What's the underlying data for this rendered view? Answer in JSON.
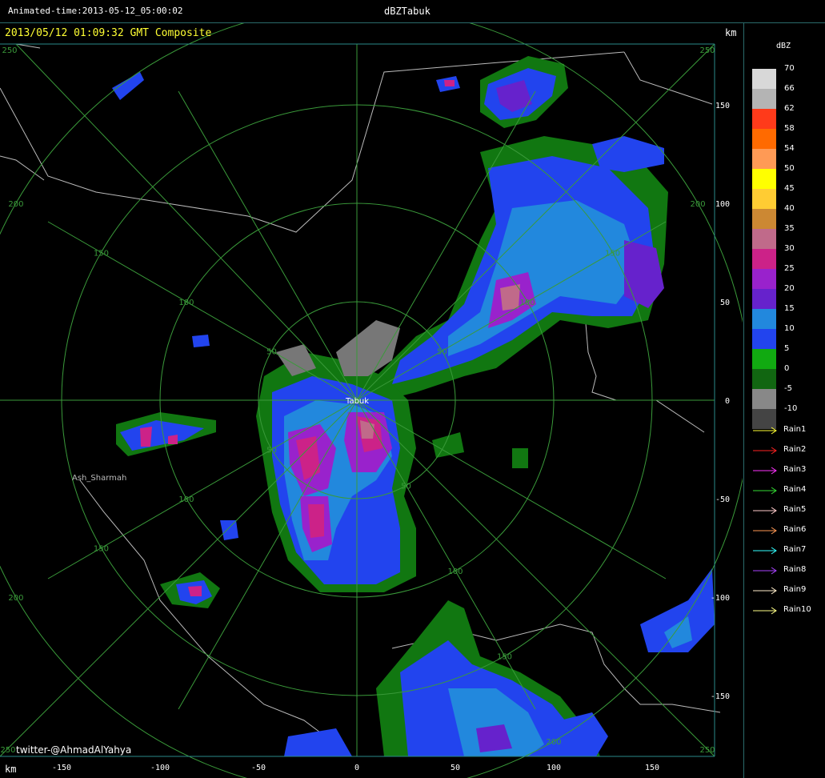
{
  "header": {
    "animated_time": "Animated-time:2013-05-12_05:00:02",
    "title": "dBZTabuk"
  },
  "map": {
    "subtitle": "2013/05/12 01:09:32 GMT Composite",
    "km_label": "km",
    "station_label": "Tabuk",
    "place_label": "Ash_Sharmah",
    "credit": "twitter-@AhmadAlYahya",
    "x_ticks": [
      "-150",
      "-100",
      "-50",
      "0",
      "50",
      "100",
      "150"
    ],
    "y_ticks": [
      "150",
      "100",
      "50",
      "0",
      "-50",
      "-100",
      "-150"
    ],
    "corner_labels": [
      "250",
      "250",
      "250",
      "250"
    ],
    "ring_labels": [
      "50",
      "100",
      "150",
      "200"
    ]
  },
  "legend": {
    "title": "dBZ",
    "scale": [
      {
        "label": "70",
        "color": "#d8d8d8"
      },
      {
        "label": "66",
        "color": "#b4b4b4"
      },
      {
        "label": "62",
        "color": "#ff3a1a"
      },
      {
        "label": "58",
        "color": "#ff6a00"
      },
      {
        "label": "54",
        "color": "#ff9a55"
      },
      {
        "label": "50",
        "color": "#ffff00"
      },
      {
        "label": "45",
        "color": "#ffcc33"
      },
      {
        "label": "40",
        "color": "#cc8833"
      },
      {
        "label": "35",
        "color": "#c06a8a"
      },
      {
        "label": "30",
        "color": "#cc2288"
      },
      {
        "label": "25",
        "color": "#9922cc"
      },
      {
        "label": "20",
        "color": "#6622cc"
      },
      {
        "label": "15",
        "color": "#2288dd"
      },
      {
        "label": "10",
        "color": "#2244ee"
      },
      {
        "label": "5",
        "color": "#11aa11"
      },
      {
        "label": "0",
        "color": "#116611"
      },
      {
        "label": "-5",
        "color": "#888888"
      },
      {
        "label": "-10",
        "color": "#444444"
      }
    ],
    "rain_items": [
      {
        "label": "Rain1",
        "color": "#ffff33"
      },
      {
        "label": "Rain2",
        "color": "#ff2222"
      },
      {
        "label": "Rain3",
        "color": "#ff33ff"
      },
      {
        "label": "Rain4",
        "color": "#33dd33"
      },
      {
        "label": "Rain5",
        "color": "#ffcccc"
      },
      {
        "label": "Rain6",
        "color": "#ff9955"
      },
      {
        "label": "Rain7",
        "color": "#33ffff"
      },
      {
        "label": "Rain8",
        "color": "#aa44ff"
      },
      {
        "label": "Rain9",
        "color": "#ffeecc"
      },
      {
        "label": "Rain10",
        "color": "#ffff88"
      }
    ]
  }
}
